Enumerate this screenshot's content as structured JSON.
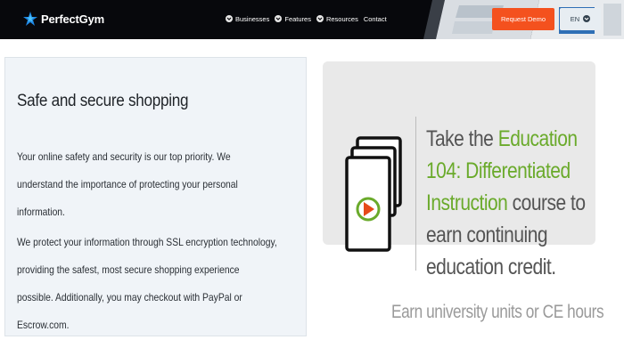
{
  "header": {
    "logo_text": "PerfectGym",
    "nav": [
      {
        "label": "Businesses",
        "icon": "chevron-down-icon"
      },
      {
        "label": "Features",
        "icon": "chevron-down-icon"
      },
      {
        "label": "Resources",
        "icon": "chevron-down-icon"
      },
      {
        "label": "Contact"
      }
    ],
    "cta_label": "Request Demo",
    "lang_label": "EN",
    "colors": {
      "background": "#07080c",
      "cta": "#f4511e",
      "lang_bg": "#e7edf2"
    }
  },
  "left": {
    "title": "Safe and secure shopping",
    "paragraph1": "Your online safety and security is our top priority. We understand the importance of protecting your personal information.",
    "paragraph2": "We protect your information through SSL encryption technology, providing the safest, most secure shopping experience possible. Additionally, you may checkout with PayPal or Escrow.com."
  },
  "right": {
    "promo_pre": "Take the ",
    "promo_highlight": "Education 104: Differentiated Instruction",
    "promo_post": " course to earn continuing education credit.",
    "subtext": "Earn university units or CE hours",
    "accent_color": "#6aaa2b"
  }
}
